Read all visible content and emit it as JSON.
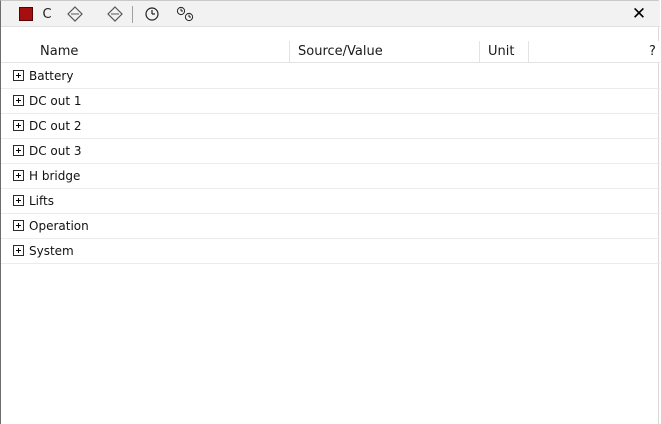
{
  "toolbar": {
    "clear_label": "C",
    "close_glyph": "✕",
    "icons": {
      "stop": "stop-square-icon",
      "diamond_1": "diamond-icon",
      "diamond_2": "diamond-icon",
      "clock": "clock-icon",
      "dual_clock": "dual-clock-icon",
      "close": "close-icon"
    },
    "stop_color": "#a50f0f"
  },
  "columns": {
    "name": "Name",
    "source_value": "Source/Value",
    "unit": "Unit",
    "help": "?"
  },
  "tree_items": [
    {
      "label": "Battery"
    },
    {
      "label": "DC out 1"
    },
    {
      "label": "DC out 2"
    },
    {
      "label": "DC out 3"
    },
    {
      "label": "H bridge"
    },
    {
      "label": "Lifts"
    },
    {
      "label": "Operation"
    },
    {
      "label": "System"
    }
  ]
}
